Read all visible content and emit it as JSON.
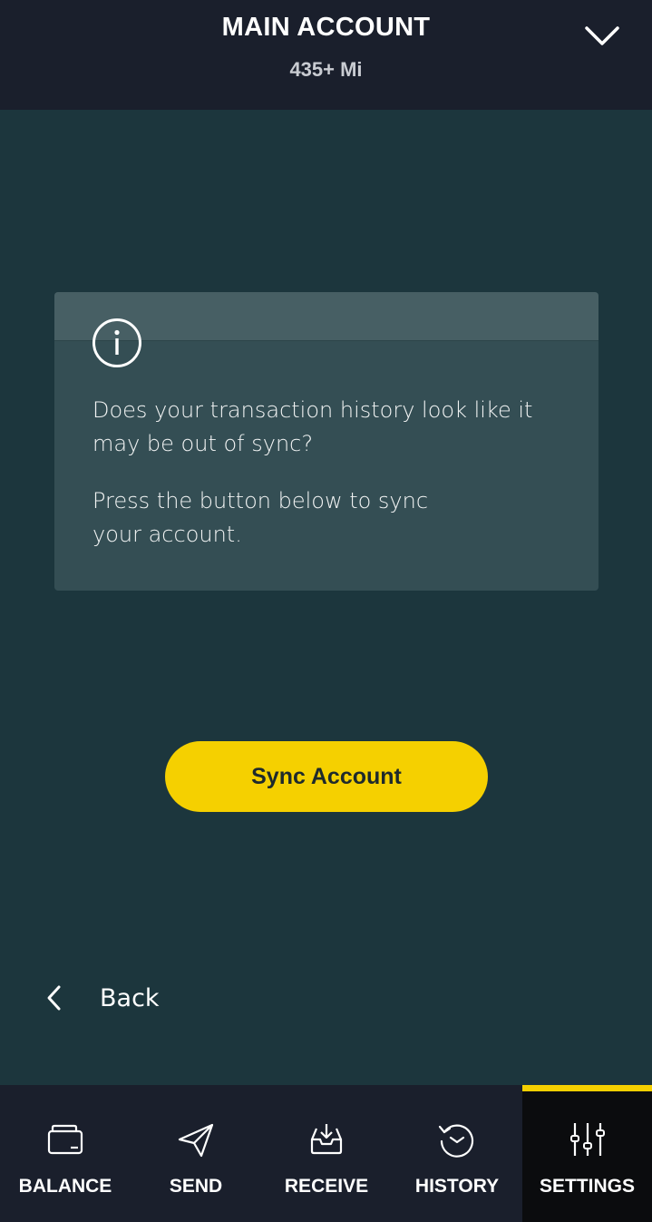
{
  "header": {
    "account_title": "MAIN ACCOUNT",
    "balance": "435+ Mi",
    "dropdown_icon": "chevron-down-icon"
  },
  "info_card": {
    "icon": "info-icon",
    "paragraph_1": "Does your transaction history look like it may be out of sync?",
    "paragraph_2": "Press the button below to sync your account."
  },
  "sync_button": {
    "label": "Sync Account"
  },
  "back": {
    "icon": "chevron-left-icon",
    "label": "Back"
  },
  "tabs": [
    {
      "label": "BALANCE",
      "icon": "wallet-icon",
      "active": false
    },
    {
      "label": "SEND",
      "icon": "paper-plane-icon",
      "active": false
    },
    {
      "label": "RECEIVE",
      "icon": "inbox-download-icon",
      "active": false
    },
    {
      "label": "HISTORY",
      "icon": "clock-history-icon",
      "active": false
    },
    {
      "label": "SETTINGS",
      "icon": "sliders-icon",
      "active": true
    }
  ],
  "colors": {
    "background": "#1c363d",
    "header": "#1a1f2c",
    "card": "#344e54",
    "accent": "#f5d000",
    "active_tab": "#0b0c0e"
  }
}
